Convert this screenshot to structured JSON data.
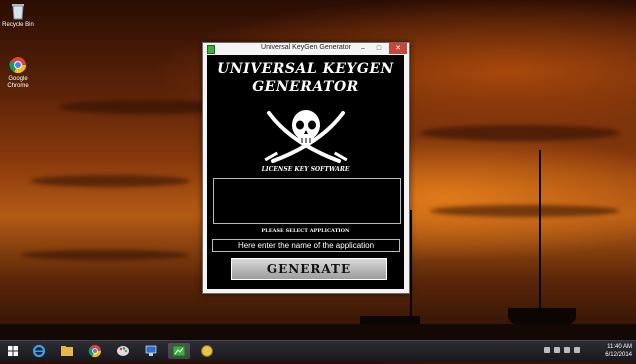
{
  "desktop": {
    "icons": [
      {
        "label": "Recycle Bin",
        "icon": "recycle-bin-icon"
      },
      {
        "label": "Google Chrome",
        "icon": "chrome-icon"
      }
    ]
  },
  "window": {
    "title": "Universal KeyGen Generator",
    "controls": {
      "minimize": "–",
      "maximize": "□",
      "close": "✕"
    },
    "heading_line1": "UNIVERSAL KEYGEN",
    "heading_line2": "GENERATOR",
    "logo": "skull-crossed-swords-icon",
    "tagline": "LICENSE KEY SOFTWARE",
    "output_value": "",
    "select_label": "PLEASE SELECT APPLICATION",
    "app_input_value": "Here enter the name of the application",
    "generate_label": "GENERATE"
  },
  "taskbar": {
    "items": [
      "start-icon",
      "internet-explorer-icon",
      "file-explorer-icon",
      "chrome-icon",
      "paint-icon",
      "network-icon",
      "keygen-icon",
      "folder-icon"
    ],
    "time": "11:40 AM",
    "date": "6/12/2014"
  }
}
